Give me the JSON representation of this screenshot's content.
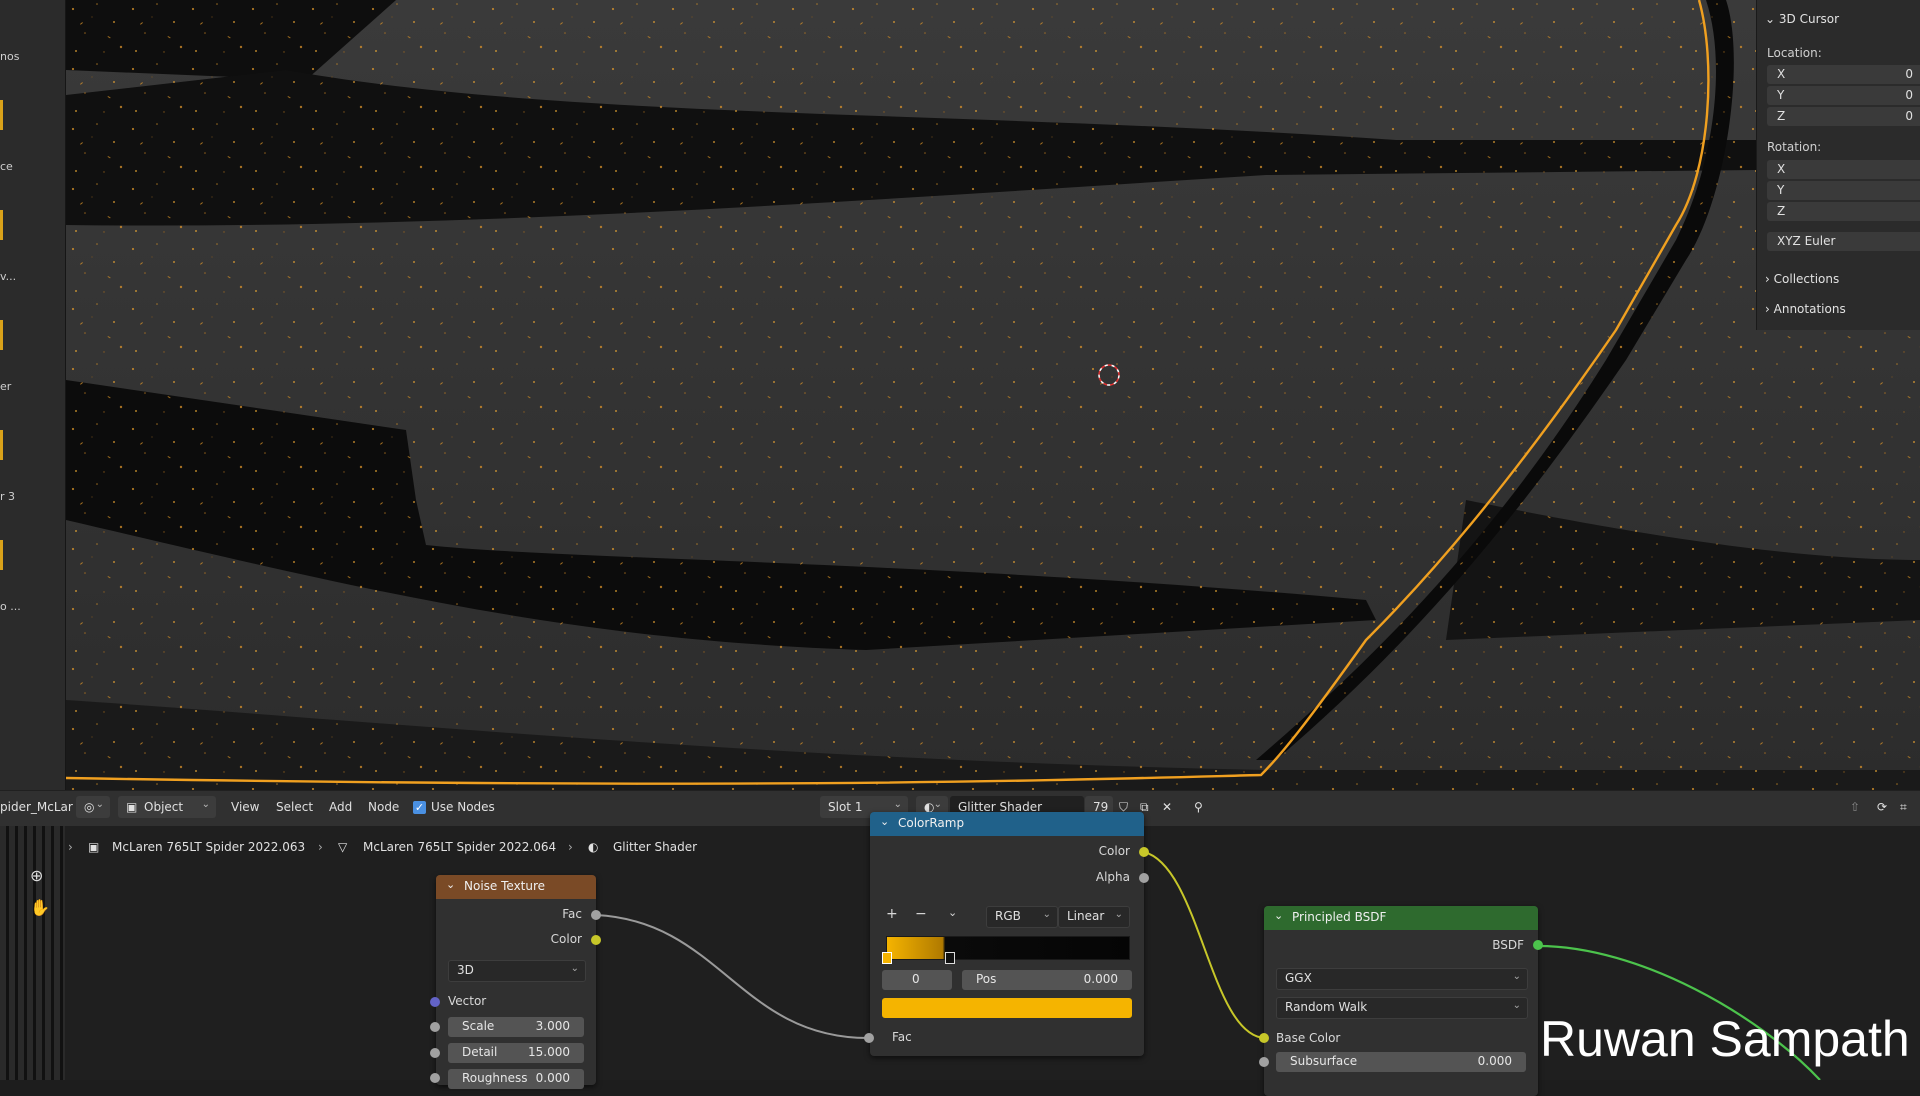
{
  "left_panel": {
    "labels": [
      "nos",
      "ce",
      "v...",
      "er",
      "r 3",
      "o ..."
    ]
  },
  "n_panel": {
    "cursor_header": "3D Cursor",
    "location_label": "Location:",
    "location": [
      {
        "axis": "X",
        "value": "0"
      },
      {
        "axis": "Y",
        "value": "0"
      },
      {
        "axis": "Z",
        "value": "0"
      }
    ],
    "rotation_label": "Rotation:",
    "rotation": [
      {
        "axis": "X"
      },
      {
        "axis": "Y"
      },
      {
        "axis": "Z"
      }
    ],
    "rotation_mode": "XYZ Euler",
    "collections": "Collections",
    "annotations": "Annotations"
  },
  "header": {
    "object_name": "pider_McLar",
    "mode": "Object",
    "menu": [
      "View",
      "Select",
      "Add",
      "Node"
    ],
    "use_nodes_label": "Use Nodes",
    "use_nodes_checked": true,
    "slot": "Slot 1",
    "material_name": "Glitter Shader",
    "user_count": "79"
  },
  "breadcrumbs": [
    {
      "label": "McLaren 765LT Spider 2022.063",
      "icon": "object-icon"
    },
    {
      "label": "McLaren 765LT Spider 2022.064",
      "icon": "mesh-icon"
    },
    {
      "label": "Glitter Shader",
      "icon": "material-icon"
    }
  ],
  "nodes": {
    "noise": {
      "title": "Noise Texture",
      "outputs": [
        "Fac",
        "Color"
      ],
      "dimensions": "3D",
      "vector_label": "Vector",
      "scale_label": "Scale",
      "scale_value": "3.000",
      "detail_label": "Detail",
      "detail_value": "15.000",
      "roughness_label": "Roughness",
      "roughness_value": "0.000"
    },
    "colorramp": {
      "title": "ColorRamp",
      "outputs": [
        "Color",
        "Alpha"
      ],
      "color_mode": "RGB",
      "interpolation": "Linear",
      "index": "0",
      "pos_label": "Pos",
      "pos_value": "0.000",
      "input_fac": "Fac",
      "stop_color": "#f5b400"
    },
    "bsdf": {
      "title": "Principled BSDF",
      "output": "BSDF",
      "distribution": "GGX",
      "subsurface_method": "Random Walk",
      "base_color_label": "Base Color",
      "subsurface_label": "Subsurface",
      "subsurface_value": "0.000"
    }
  },
  "watermark": "Ruwan Sampath",
  "colors": {
    "accent_orange": "#f0a020",
    "noise_header": "#7a4a26",
    "colorramp_header": "#20618a",
    "bsdf_header": "#2e6a2e",
    "shader_link": "#4cc34c",
    "color_link": "#c7c729"
  }
}
